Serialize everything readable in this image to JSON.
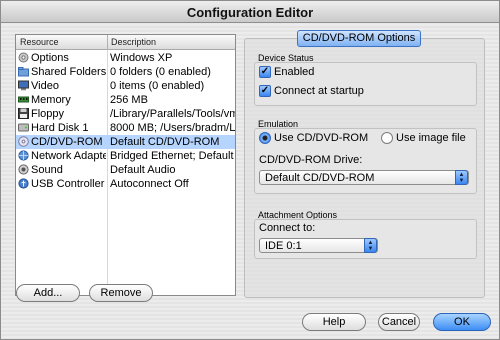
{
  "window": {
    "title": "Configuration Editor"
  },
  "table": {
    "columns": [
      "Resource",
      "Description"
    ],
    "rows": [
      {
        "icon": "options-icon",
        "name": "Options",
        "desc": "Windows XP"
      },
      {
        "icon": "shared-folders-icon",
        "name": "Shared Folders",
        "desc": "0 folders (0 enabled)"
      },
      {
        "icon": "video-icon",
        "name": "Video",
        "desc": "0 items (0 enabled)"
      },
      {
        "icon": "memory-icon",
        "name": "Memory",
        "desc": "256 MB"
      },
      {
        "icon": "floppy-icon",
        "name": "Floppy",
        "desc": "/Library/Parallels/Tools/vm"
      },
      {
        "icon": "hard-disk-icon",
        "name": "Hard Disk 1",
        "desc": "8000 MB; /Users/bradm/Lib"
      },
      {
        "icon": "cd-dvd-icon",
        "name": "CD/DVD-ROM 1",
        "desc": "Default CD/DVD-ROM",
        "selected": true
      },
      {
        "icon": "network-adapter-icon",
        "name": "Network Adapter",
        "desc": "Bridged Ethernet; Default Ac"
      },
      {
        "icon": "sound-icon",
        "name": "Sound",
        "desc": "Default Audio"
      },
      {
        "icon": "usb-icon",
        "name": "USB Controller",
        "desc": "Autoconnect Off"
      }
    ]
  },
  "buttons": {
    "add": "Add...",
    "remove": "Remove",
    "help": "Help",
    "cancel": "Cancel",
    "ok": "OK"
  },
  "panel": {
    "tab": "CD/DVD-ROM Options",
    "device_status": {
      "title": "Device Status",
      "enabled": {
        "label": "Enabled",
        "checked": true
      },
      "connect": {
        "label": "Connect at startup",
        "checked": true
      }
    },
    "emulation": {
      "title": "Emulation",
      "use_drive": {
        "label": "Use CD/DVD-ROM",
        "selected": true
      },
      "use_image": {
        "label": "Use image file",
        "selected": false
      },
      "drive_label": "CD/DVD-ROM Drive:",
      "drive_value": "Default CD/DVD-ROM"
    },
    "attachment": {
      "title": "Attachment Options",
      "connect_label": "Connect to:",
      "connect_value": "IDE 0:1"
    }
  },
  "colors": {
    "selection": "#b5d5ff",
    "accent": "#3b86f0"
  }
}
